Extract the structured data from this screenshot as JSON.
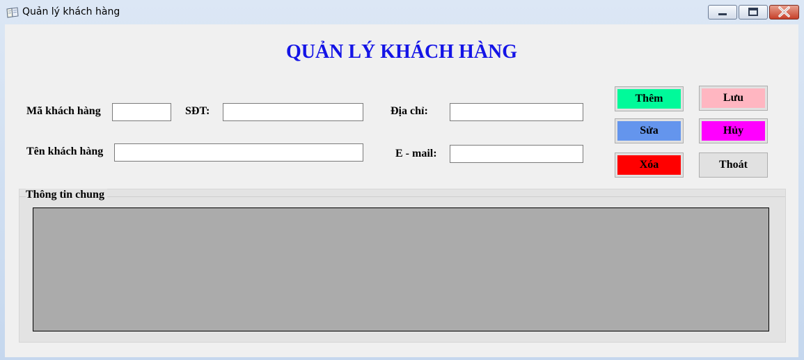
{
  "window": {
    "title": "Quản lý khách hàng"
  },
  "form": {
    "heading": "QUẢN LÝ KHÁCH HÀNG",
    "fields": {
      "ma_kh_label": "Mã khách hàng",
      "ma_kh_value": "",
      "sdt_label": "SĐT:",
      "sdt_value": "",
      "dia_chi_label": "Địa chỉ:",
      "dia_chi_value": "",
      "ten_kh_label": "Tên khách hàng",
      "ten_kh_value": "",
      "email_label": "E - mail:",
      "email_value": ""
    },
    "buttons": {
      "them": "Thêm",
      "luu": "Lưu",
      "sua": "Sửa",
      "huy": "Hủy",
      "xoa": "Xóa",
      "thoat": "Thoát"
    },
    "group": {
      "title": "Thông tin chung"
    }
  },
  "colors": {
    "heading": "#1414e6",
    "them": "#00fa9a",
    "luu": "#ffb6c1",
    "sua": "#6495ed",
    "huy": "#ff00ff",
    "xoa": "#ff0000",
    "thoat": "#e1e1e1",
    "grid": "#ababab"
  },
  "icons": {
    "app": "book-icon",
    "minimize": "minimize-icon",
    "maximize": "maximize-icon",
    "close": "close-icon"
  }
}
